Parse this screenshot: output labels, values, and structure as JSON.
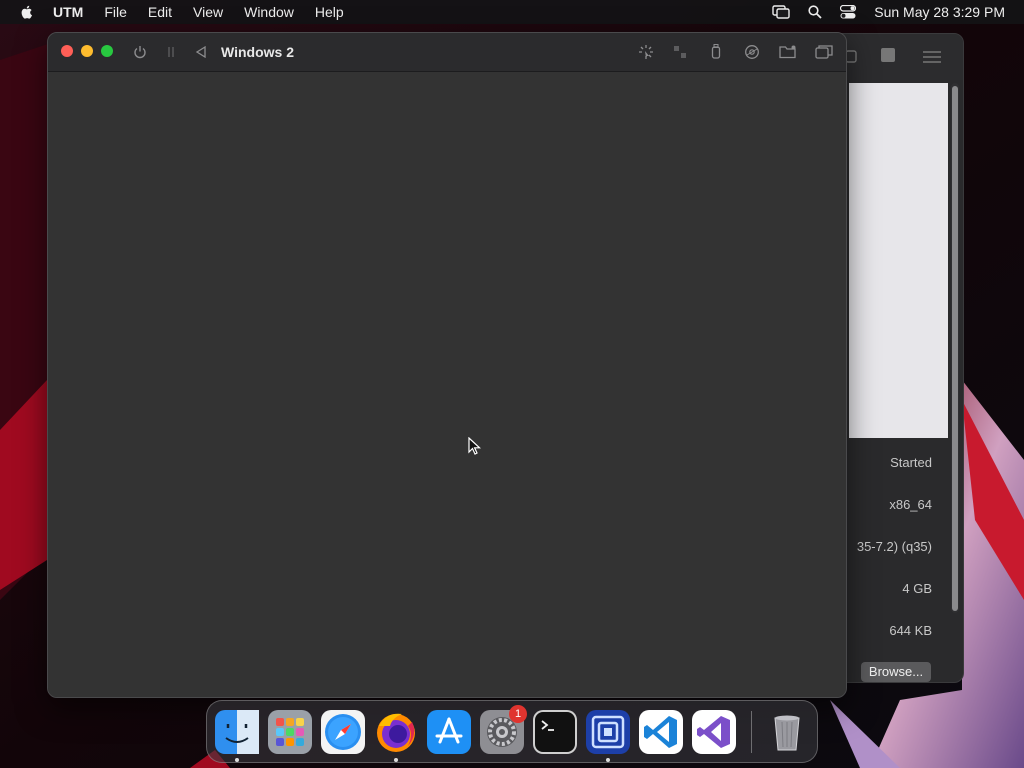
{
  "menubar": {
    "apple_icon": "apple-icon",
    "items": [
      "UTM",
      "File",
      "Edit",
      "View",
      "Window",
      "Help"
    ],
    "clock": "Sun May 28  3:29 PM",
    "icons": [
      "screen-mirroring-icon",
      "search-icon",
      "control-center-icon"
    ]
  },
  "vm_window": {
    "title": "Windows 2",
    "toolbar_icons": [
      "power-icon",
      "pause-icon",
      "restart-icon",
      "input-capture-icon",
      "resize-icon",
      "usb-icon",
      "drive-icon",
      "shared-folder-icon",
      "windows-icon"
    ]
  },
  "main_window": {
    "info": {
      "status": "Started",
      "architecture": "x86_64",
      "machine": "35-7.2) (q35)",
      "memory": "4 GB",
      "size": "644 KB"
    },
    "browse_button": "Browse..."
  },
  "dock": {
    "apps": [
      "Finder",
      "Launchpad",
      "Safari",
      "Firefox",
      "App Store",
      "System Settings",
      "Terminal",
      "UTM",
      "Visual Studio Code",
      "Visual Studio",
      "Trash"
    ],
    "settings_badge": "1"
  },
  "colors": {
    "wallpaper_red": "#b0102a",
    "window_bg": "#323232",
    "titlebar": "#2b2b2d",
    "close": "#ff5f57",
    "minimize": "#febc2e",
    "zoom": "#28c840"
  }
}
